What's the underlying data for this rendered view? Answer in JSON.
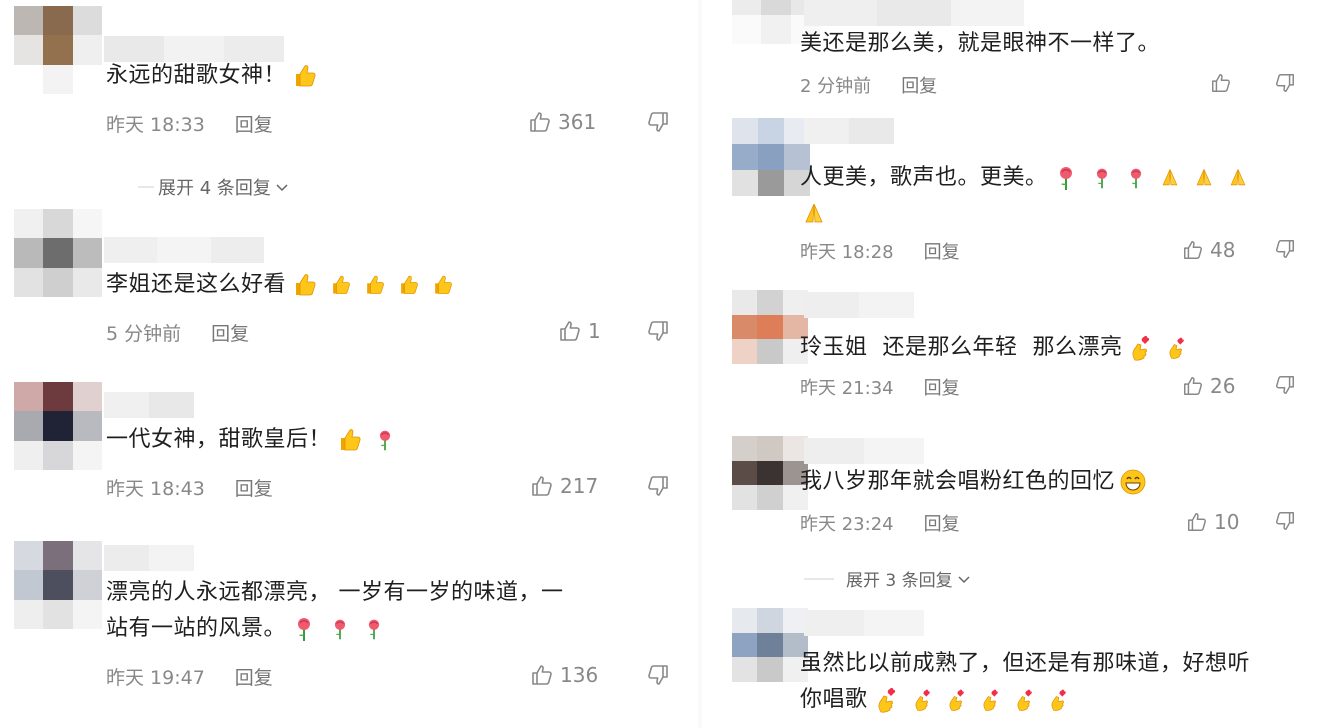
{
  "left": [
    {
      "text": "永远的甜歌女神！",
      "emojis": [
        "thumbs-up"
      ],
      "time": "昨天 18:33",
      "reply_label": "回复",
      "likes": "361",
      "expand": "展开 4 条回复"
    },
    {
      "text": "李姐还是这么好看",
      "emojis": [
        "thumbs-up",
        "thumbs-up",
        "thumbs-up",
        "thumbs-up",
        "thumbs-up"
      ],
      "time": "5 分钟前",
      "reply_label": "回复",
      "likes": "1"
    },
    {
      "text": "一代女神，甜歌皇后！",
      "emojis": [
        "thumbs-up",
        "rose"
      ],
      "time": "昨天 18:43",
      "reply_label": "回复",
      "likes": "217"
    },
    {
      "text_line1": "漂亮的人永远都漂亮， 一岁有一岁的味道，一",
      "text_line2": "站有一站的风景。",
      "emojis": [
        "rose",
        "rose",
        "rose"
      ],
      "time": "昨天 19:47",
      "reply_label": "回复",
      "likes": "136"
    }
  ],
  "right": [
    {
      "text": "美还是那么美，就是眼神不一样了。",
      "time": "2 分钟前",
      "reply_label": "回复",
      "likes": ""
    },
    {
      "text": "人更美，歌声也。更美。",
      "emojis": [
        "rose",
        "rose",
        "rose",
        "pray",
        "pray",
        "pray",
        "pray"
      ],
      "time": "昨天 18:28",
      "reply_label": "回复",
      "likes": "48"
    },
    {
      "text": "玲玉姐  还是那么年轻  那么漂亮",
      "emojis": [
        "finger-heart",
        "finger-heart"
      ],
      "time": "昨天 21:34",
      "reply_label": "回复",
      "likes": "26"
    },
    {
      "text": "我八岁那年就会唱粉红色的回忆",
      "emojis": [
        "grin"
      ],
      "time": "昨天 23:24",
      "reply_label": "回复",
      "likes": "10",
      "expand": "展开 3 条回复"
    },
    {
      "text_line1": "虽然比以前成熟了，但还是有那味道，好想听",
      "text_line2": "你唱歌",
      "emojis": [
        "finger-heart",
        "finger-heart",
        "finger-heart",
        "finger-heart",
        "finger-heart",
        "finger-heart"
      ]
    }
  ],
  "icons": {
    "like": "thumb-up-outline-icon",
    "dislike": "thumb-down-outline-icon",
    "expand": "chevron-down-icon"
  },
  "colors": {
    "text": "#1f1f1f",
    "meta": "#888888",
    "background": "#ffffff"
  }
}
